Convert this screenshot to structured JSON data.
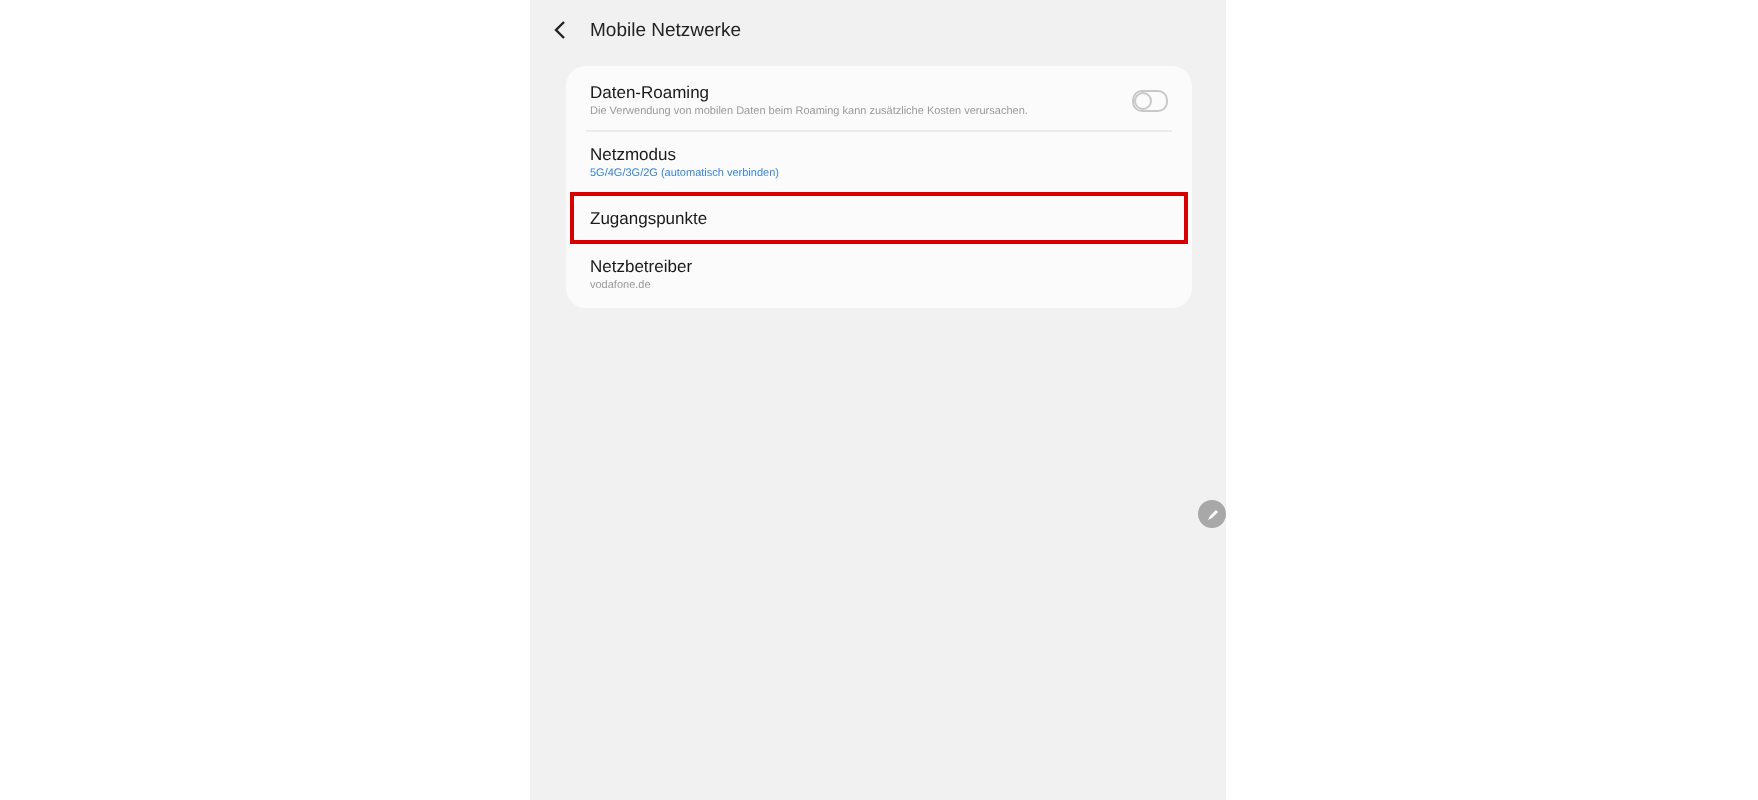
{
  "header": {
    "title": "Mobile Netzwerke"
  },
  "items": [
    {
      "kind": "toggle",
      "title": "Daten-Roaming",
      "subtitle": "Die Verwendung von mobilen Daten beim Roaming kann zusätzliche Kosten verursachen.",
      "accent": false,
      "on": false,
      "highlighted": false
    },
    {
      "kind": "plain",
      "title": "Netzmodus",
      "subtitle": "5G/4G/3G/2G (automatisch verbinden)",
      "accent": true,
      "highlighted": false
    },
    {
      "kind": "plain",
      "title": "Zugangspunkte",
      "highlighted": true
    },
    {
      "kind": "plain",
      "title": "Netzbetreiber",
      "subtitle": "vodafone.de",
      "accent": false,
      "highlighted": false
    }
  ]
}
